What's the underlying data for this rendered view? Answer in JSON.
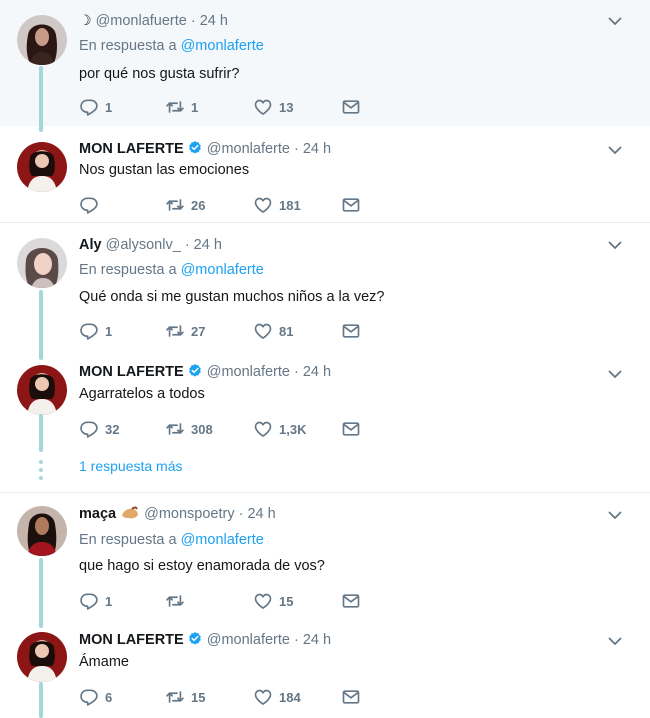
{
  "colors": {
    "accent": "#1da1f2",
    "thread": "#a3d8d9",
    "muted": "#657786"
  },
  "tweets": [
    {
      "moon": "☽",
      "handle": "@monlafuerte",
      "time": "· 24 h",
      "reply_label": "En respuesta a",
      "reply_mention": "@monlaferte",
      "text": "por qué nos gusta sufrir?",
      "replies": "1",
      "retweets": "1",
      "likes": "13"
    },
    {
      "name": "MON LAFERTE",
      "handle": "@monlaferte",
      "time": "· 24 h",
      "text": "Nos gustan las emociones",
      "replies": "",
      "retweets": "26",
      "likes": "181"
    },
    {
      "name": "Aly",
      "handle": "@alysonlv_",
      "time": "· 24 h",
      "reply_label": "En respuesta a",
      "reply_mention": "@monlaferte",
      "text": "Qué onda si me gustan muchos niños a la vez?",
      "replies": "1",
      "retweets": "27",
      "likes": "81"
    },
    {
      "name": "MON LAFERTE",
      "handle": "@monlaferte",
      "time": "· 24 h",
      "text": "Agarratelos a todos",
      "replies": "32",
      "retweets": "308",
      "likes": "1,3K"
    },
    {
      "name": "maça",
      "handle": "@monspoetry",
      "time": "· 24 h",
      "reply_label": "En respuesta a",
      "reply_mention": "@monlaferte",
      "text": "que hago si estoy enamorada de vos?",
      "replies": "1",
      "retweets": "",
      "likes": "15"
    },
    {
      "name": "MON LAFERTE",
      "handle": "@monlaferte",
      "time": "· 24 h",
      "text": "Ámame",
      "replies": "6",
      "retweets": "15",
      "likes": "184"
    }
  ],
  "more_replies": "1 respuesta más",
  "icons": [
    "reply-icon",
    "retweet-icon",
    "like-icon",
    "direct-message-icon",
    "chevron-down-icon",
    "verified-badge-icon"
  ]
}
